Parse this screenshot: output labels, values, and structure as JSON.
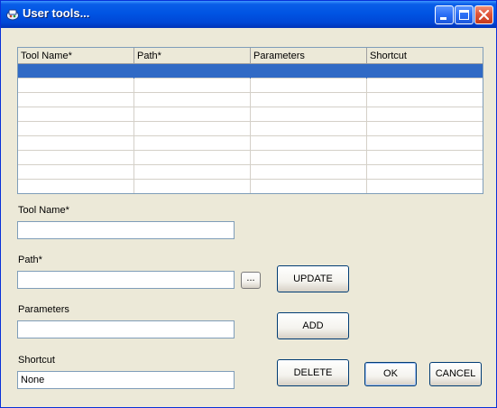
{
  "window": {
    "title": "User tools..."
  },
  "grid": {
    "columns": [
      "Tool Name*",
      "Path*",
      "Parameters",
      "Shortcut"
    ],
    "rows": [
      [
        "",
        "",
        "",
        ""
      ],
      [
        "",
        "",
        "",
        ""
      ],
      [
        "",
        "",
        "",
        ""
      ],
      [
        "",
        "",
        "",
        ""
      ],
      [
        "",
        "",
        "",
        ""
      ],
      [
        "",
        "",
        "",
        ""
      ],
      [
        "",
        "",
        "",
        ""
      ],
      [
        "",
        "",
        "",
        ""
      ],
      [
        "",
        "",
        "",
        ""
      ]
    ],
    "selected_row": 0
  },
  "form": {
    "tool_name": {
      "label": "Tool Name*",
      "value": ""
    },
    "path": {
      "label": "Path*",
      "value": "",
      "browse_label": "..."
    },
    "parameters": {
      "label": "Parameters",
      "value": ""
    },
    "shortcut": {
      "label": "Shortcut",
      "value": "None"
    }
  },
  "buttons": {
    "update": "UPDATE",
    "add": "ADD",
    "delete": "DELETE",
    "ok": "OK",
    "cancel": "CANCEL"
  }
}
